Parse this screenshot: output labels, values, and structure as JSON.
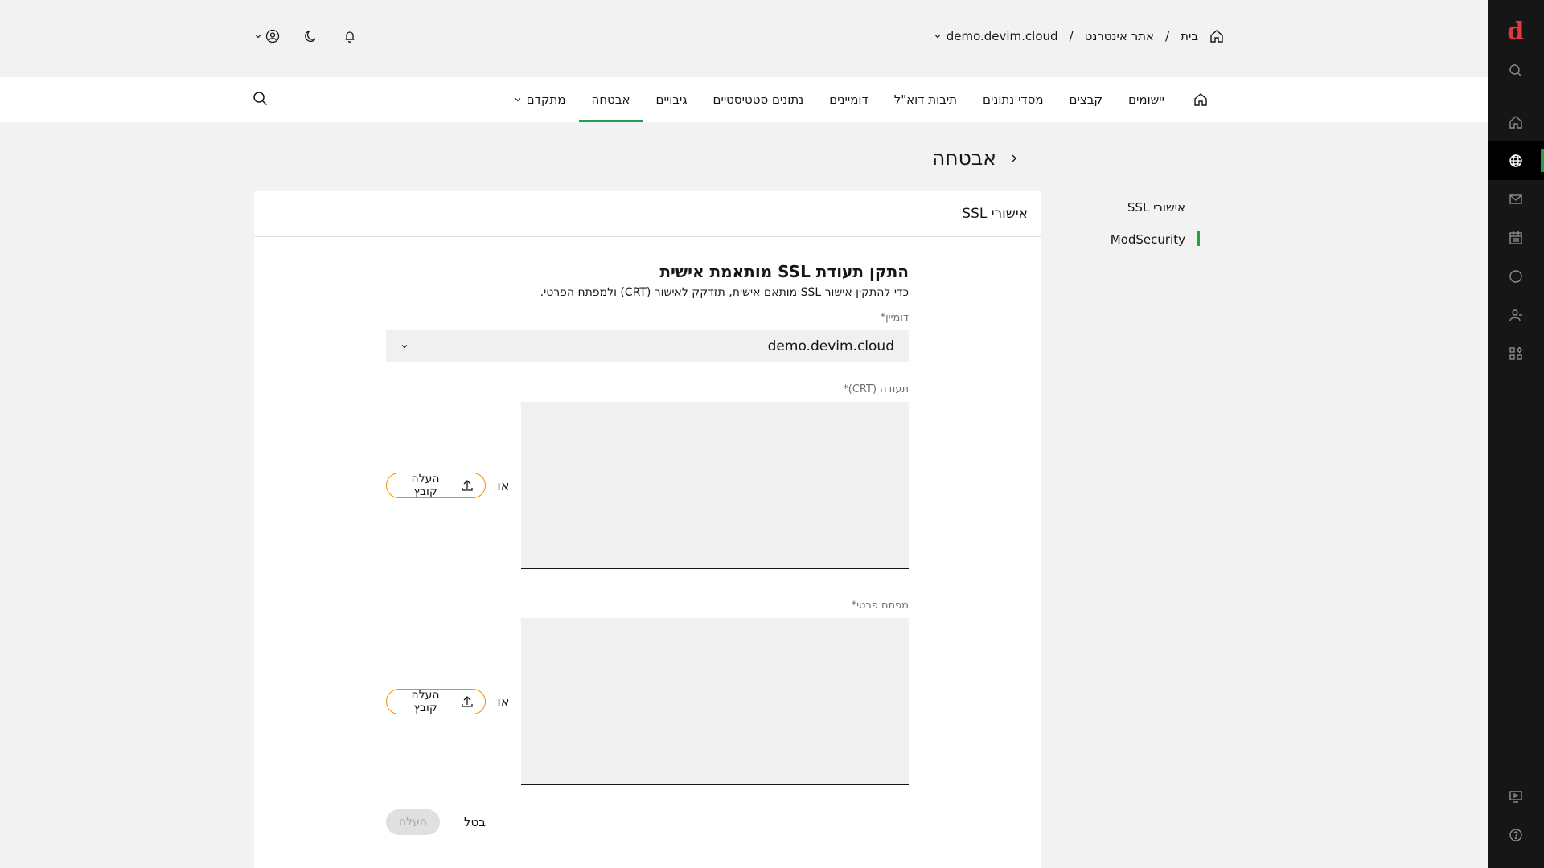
{
  "colors": {
    "accent": "#24a148",
    "upload_border": "#f08c00",
    "rail_bg": "#161616",
    "logo": "#e0383e"
  },
  "rail": {
    "logo": "d",
    "icons": [
      "search-icon",
      "home-icon",
      "globe-icon",
      "mail-icon",
      "calendar-icon",
      "circle-icon",
      "user-group-icon",
      "apps-icon",
      "screen-icon",
      "help-icon"
    ]
  },
  "breadcrumb": {
    "home": "בית",
    "section": "אתר אינטרנט",
    "domain": "demo.devim.cloud",
    "separator": "/"
  },
  "nav": {
    "items": [
      "יישומים",
      "קבצים",
      "מסדי נתונים",
      "תיבות דוא\"ל",
      "דומיינים",
      "נתונים סטטיסטיים",
      "גיבויים",
      "אבטחה",
      "מתקדם"
    ],
    "active": "אבטחה"
  },
  "page": {
    "title": "אבטחה"
  },
  "sidemenu": {
    "items": [
      "אישורי SSL",
      "ModSecurity"
    ],
    "active": "ModSecurity"
  },
  "card": {
    "title": "אישורי SSL"
  },
  "form": {
    "title": "התקן תעודת SSL מותאמת אישית",
    "description": "כדי להתקין אישור SSL מותאם אישית, תזדקק לאישור (CRT) ולמפתח הפרטי.",
    "domain_label": "דומיין*",
    "domain_value": "demo.devim.cloud",
    "crt_label": "תעודה (CRT)*",
    "key_label": "מפתח פרטי*",
    "or": "או",
    "upload_file": "העלה קובץ",
    "cancel": "בטל",
    "submit": "העלה"
  }
}
